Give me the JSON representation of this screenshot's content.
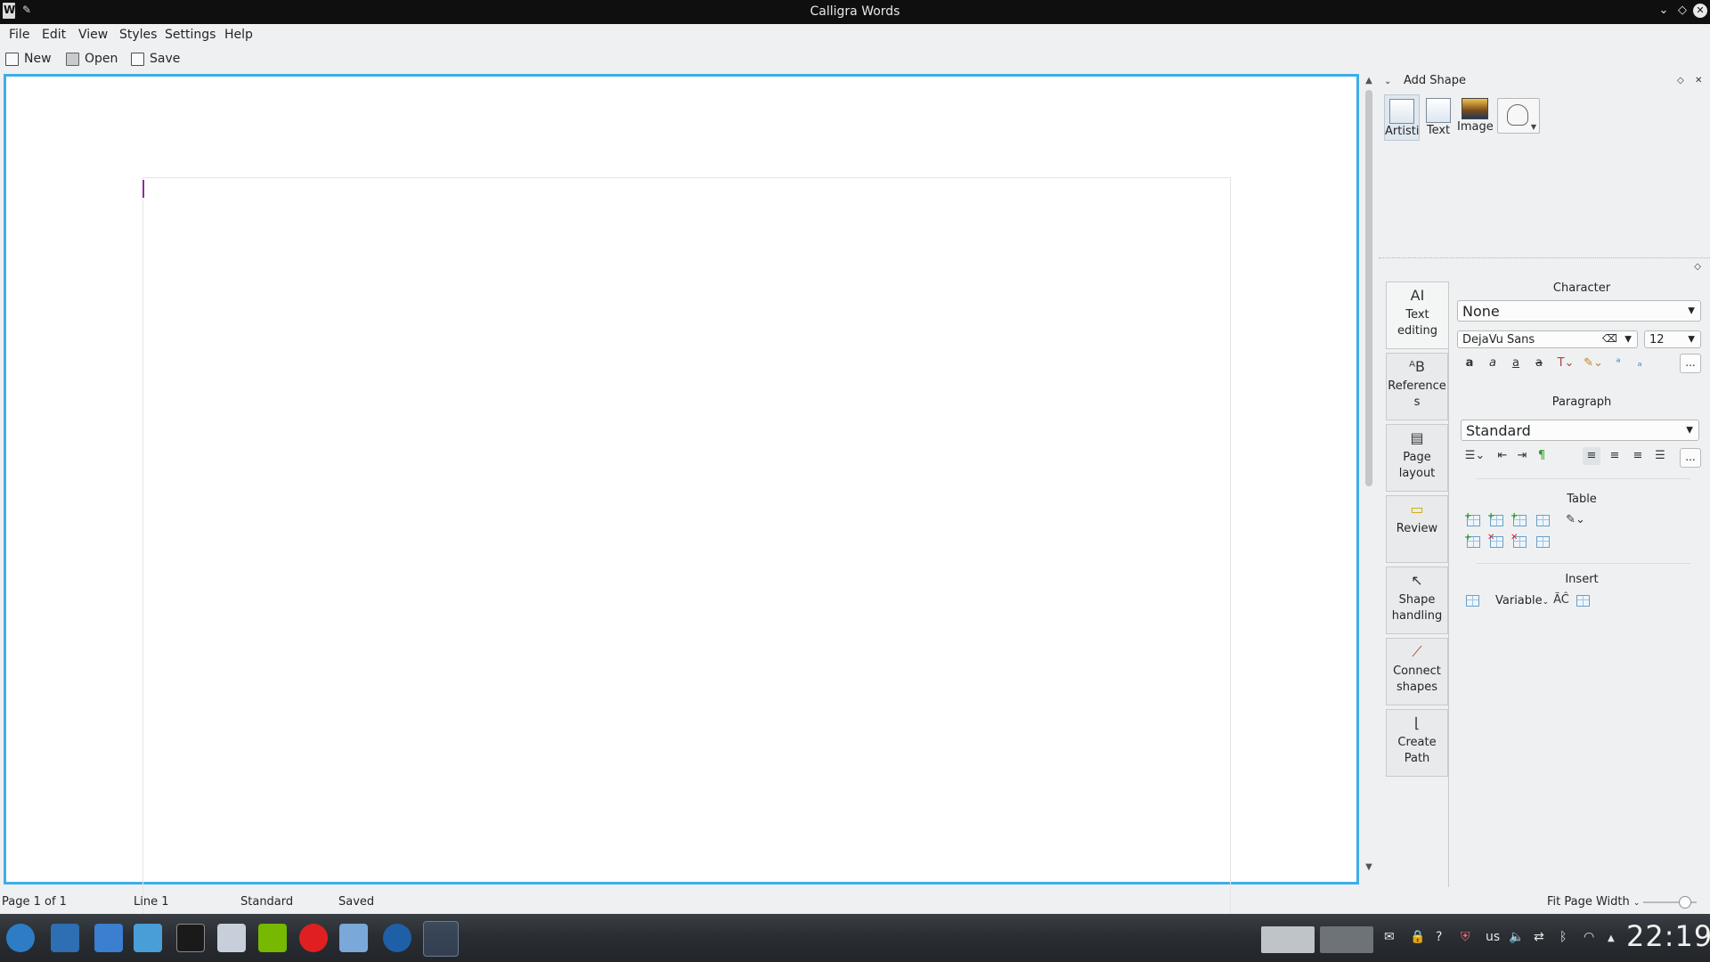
{
  "window": {
    "title": "Calligra Words"
  },
  "menu": [
    "File",
    "Edit",
    "View",
    "Styles",
    "Settings",
    "Help"
  ],
  "toolbar": {
    "new_label": "New",
    "open_label": "Open",
    "save_label": "Save"
  },
  "add_shape": {
    "title": "Add Shape",
    "items": [
      "Artistic",
      "Text",
      "Image"
    ]
  },
  "tools": [
    {
      "label": "Text editing",
      "icon": "text-cursor-icon"
    },
    {
      "label": "Reference s",
      "icon": "references-icon"
    },
    {
      "label": "Page layout",
      "icon": "page-layout-icon"
    },
    {
      "label": "Review",
      "icon": "review-icon"
    },
    {
      "label": "Shape handling",
      "icon": "pointer-icon"
    },
    {
      "label": "Connect shapes",
      "icon": "connector-icon"
    },
    {
      "label": "Create Path",
      "icon": "path-icon"
    }
  ],
  "character": {
    "title": "Character",
    "style_value": "None",
    "font_value": "DejaVu Sans",
    "size_value": "12"
  },
  "paragraph": {
    "title": "Paragraph",
    "style_value": "Standard"
  },
  "table": {
    "title": "Table"
  },
  "insert": {
    "title": "Insert",
    "variable_label": "Variable"
  },
  "more_label": "...",
  "status": {
    "page": "Page 1 of 1",
    "line": "Line 1",
    "style": "Standard",
    "saved": "Saved",
    "zoom": "Fit Page Width"
  },
  "taskbar": {
    "tray_lang": "us",
    "clock": "22:19"
  },
  "colors": {
    "accent": "#3daee9",
    "cursor": "#8a2da0",
    "titlebar": "#0f0f10"
  }
}
